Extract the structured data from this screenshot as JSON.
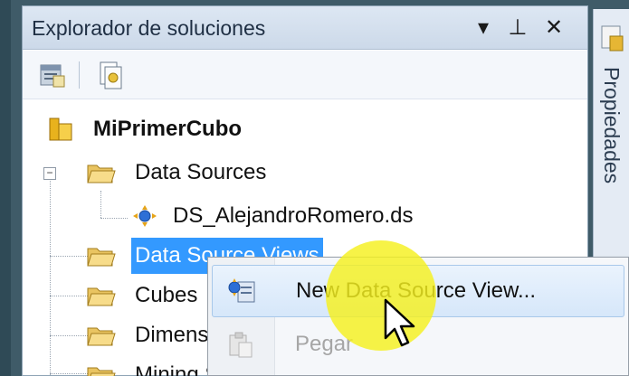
{
  "panel": {
    "title": "Explorador de soluciones",
    "buttons": {
      "dropdown": "▾",
      "pin": "⊥",
      "close": "✕"
    }
  },
  "side_tab": {
    "label": "Propiedades"
  },
  "tree": {
    "root": {
      "label": "MiPrimerCubo",
      "icon": "project-cube-icon"
    },
    "nodes": [
      {
        "label": "Data Sources",
        "icon": "folder-open-icon",
        "expanded": true
      },
      {
        "label": "DS_AlejandroRomero.ds",
        "icon": "data-source-icon"
      },
      {
        "label": "Data Source Views",
        "icon": "folder-icon",
        "selected": true
      },
      {
        "label": "Cubes",
        "icon": "folder-icon"
      },
      {
        "label": "Dimensions",
        "icon": "folder-icon"
      },
      {
        "label": "Mining Structures",
        "icon": "folder-icon"
      }
    ]
  },
  "context_menu": {
    "items": [
      {
        "label": "New Data Source View...",
        "icon": "new-dsv-icon",
        "enabled": true,
        "hover": true
      },
      {
        "label": "Pegar",
        "icon": "paste-icon",
        "enabled": false
      }
    ]
  },
  "colors": {
    "selection": "#3399ff",
    "cursor_highlight": "#f5f01e"
  }
}
